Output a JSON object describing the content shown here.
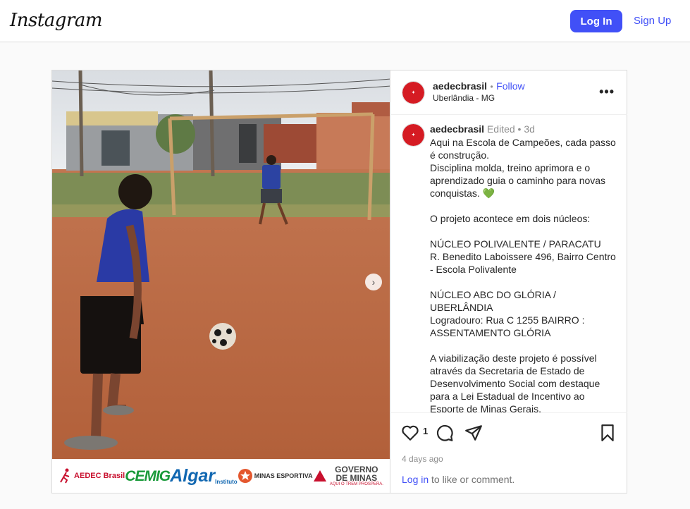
{
  "header": {
    "logo": "Instagram",
    "login_label": "Log In",
    "signup_label": "Sign Up"
  },
  "post": {
    "username": "aedecbrasil",
    "follow_separator": "•",
    "follow_label": "Follow",
    "location": "Uberlândia - MG",
    "more_label": "•••",
    "caption_username": "aedecbrasil",
    "edited_label": "Edited •",
    "time_ago": "3d",
    "caption": "Aqui na Escola de Campeões, cada passo é construção.\nDisciplina molda, treino aprimora e o aprendizado guia o caminho para novas conquistas. 💚\n\nO projeto acontece em dois núcleos:\n\nNÚCLEO POLIVALENTE / PARACATU\nR. Benedito Laboissere 496, Bairro Centro - Escola Polivalente\n\nNÚCLEO ABC DO GLÓRIA / UBERLÂNDIA\nLogradouro: Rua C 1255 BAIRRO : ASSENTAMENTO GLÓRIA\n\nA viabilização deste projeto é possível através da Secretaria de Estado de Desenvolvimento Social com destaque para a Lei Estadual de Incentivo ao Esporte de Minas Gerais.",
    "like_count": "1",
    "date": "4 days ago",
    "login_link": "Log in",
    "login_suffix": " to like or comment."
  },
  "sponsors": {
    "aedec": "AEDEC Brasil",
    "cemig": "CEMIG",
    "algar_prefix": "Instituto",
    "algar": "Algar",
    "minas": "MINAS ESPORTIVA",
    "gov_line1": "GOVERNO",
    "gov_line2": "DE MINAS",
    "gov_tagline": "AQUI O TREM PROSPERA."
  },
  "icons": {
    "heart": "heart-icon",
    "comment": "comment-icon",
    "share": "share-icon",
    "save": "bookmark-icon",
    "next": "chevron-right-icon"
  }
}
